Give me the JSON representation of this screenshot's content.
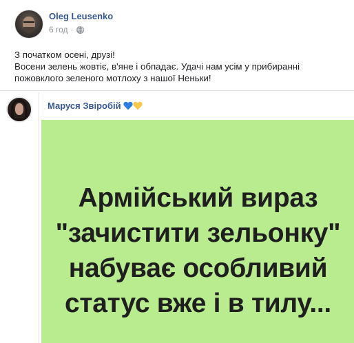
{
  "post": {
    "author": "Oleg Leusenko",
    "time": "6 год",
    "separator": "·",
    "privacy_icon": "globe-icon",
    "text_lines": [
      "З початком осені, друзі!",
      "Восени зелень жовтіє, в'яне і обпадає. Удачі нам усім у прибиранні",
      "пожовклого зеленого мотлоху з нашої Неньки!"
    ]
  },
  "shared": {
    "author": "Маруся Звіробій",
    "emoji_icons": [
      "heart-blue-icon",
      "heart-yellow-icon"
    ],
    "image_lines": [
      "Армійський вираз",
      "\"зачистити зельонку\"",
      "набуває особливий",
      "статус вже і в тилу..."
    ],
    "colors": {
      "image_background": "#b9ec8f",
      "heart_blue": "#2b7fe0",
      "heart_yellow": "#f7c948",
      "link": "#385898"
    }
  }
}
